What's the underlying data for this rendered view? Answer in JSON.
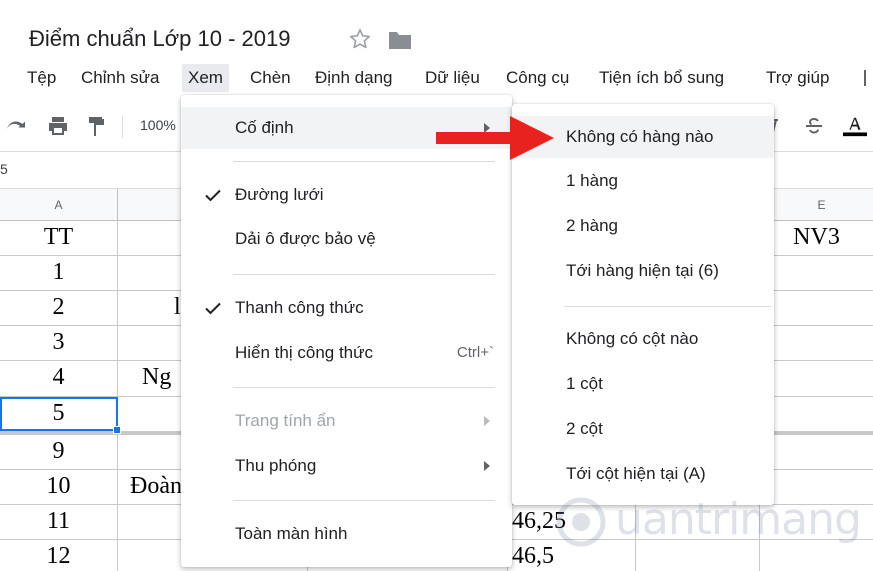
{
  "document": {
    "title": "Điểm chuẩn Lớp 10 - 2019"
  },
  "menubar": {
    "items": [
      {
        "label": "Tệp"
      },
      {
        "label": "Chỉnh sửa"
      },
      {
        "label": "Xem"
      },
      {
        "label": "Chèn"
      },
      {
        "label": "Định dạng"
      },
      {
        "label": "Dữ liệu"
      },
      {
        "label": "Công cụ"
      },
      {
        "label": "Tiện ích bổ sung"
      },
      {
        "label": "Trợ giúp"
      }
    ],
    "active_item": "Xem"
  },
  "toolbar": {
    "zoom": "100%",
    "icons": [
      "redo-icon",
      "print-icon",
      "paint-format-icon",
      "strikethrough-icon",
      "text-color-icon"
    ]
  },
  "formula_bar": {
    "cell_ref": "5"
  },
  "grid": {
    "columns": [
      "A",
      "",
      "",
      "",
      "E"
    ],
    "rows": [
      {
        "a": "TT",
        "b": "",
        "d": "",
        "e": "NV3"
      },
      {
        "a": "1",
        "b": "",
        "d": "",
        "e": ""
      },
      {
        "a": "2",
        "b": "l",
        "d": "",
        "e": ""
      },
      {
        "a": "3",
        "b": "",
        "d": "",
        "e": ""
      },
      {
        "a": "4",
        "b": "Ng",
        "d": "",
        "e": ""
      },
      {
        "a": "5",
        "b": "",
        "d": "",
        "e": ""
      },
      {
        "a": "9",
        "b": "",
        "d": "",
        "e": ""
      },
      {
        "a": "10",
        "b": "Đoàn",
        "d": "",
        "e": ""
      },
      {
        "a": "11",
        "b": "",
        "d": "46,25",
        "e": ""
      },
      {
        "a": "12",
        "b": "",
        "d": "46,5",
        "e": ""
      }
    ]
  },
  "view_menu": {
    "items": {
      "freeze": "Cố định",
      "gridlines": "Đường lưới",
      "protected_ranges": "Dải ô được bảo vệ",
      "formula_bar": "Thanh công thức",
      "show_formulas": "Hiển thị công thức",
      "show_formulas_shortcut": "Ctrl+`",
      "hidden_sheets": "Trang tính ẩn",
      "zoom": "Thu phóng",
      "full_screen": "Toàn màn hình"
    }
  },
  "freeze_submenu": {
    "items": {
      "no_rows": "Không có hàng nào",
      "one_row": "1 hàng",
      "two_rows": "2 hàng",
      "up_to_row": "Tới hàng hiện tại (6)",
      "no_columns": "Không có cột nào",
      "one_col": "1 cột",
      "two_cols": "2 cột",
      "up_to_col": "Tới cột hiện tại (A)"
    }
  },
  "colors": {
    "accent": "#1a73e8",
    "annotation_arrow": "#e8231f",
    "menu_hover": "#f1f3f4",
    "disabled_text": "#a0a4a8"
  }
}
